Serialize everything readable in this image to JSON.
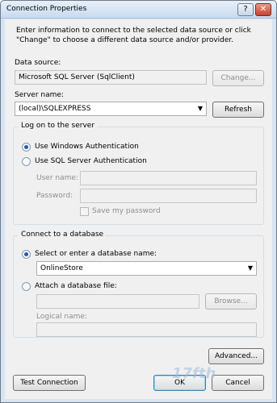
{
  "window": {
    "title": "Connection Properties",
    "help_button": "?",
    "close_button": "✕"
  },
  "intro_text": "Enter information to connect to the selected data source or click \"Change\" to choose a different data source and/or provider.",
  "data_source": {
    "label": "Data source:",
    "value": "Microsoft SQL Server (SqlClient)",
    "change_button": "Change..."
  },
  "server": {
    "label": "Server name:",
    "value": "(local)\\SQLEXPRESS",
    "refresh_button": "Refresh"
  },
  "logon": {
    "title": "Log on to the server",
    "windows_auth": "Use Windows Authentication",
    "sql_auth": "Use SQL Server Authentication",
    "user_name_label": "User name:",
    "password_label": "Password:",
    "save_password": "Save my password",
    "selected": "windows"
  },
  "database": {
    "title": "Connect to a database",
    "select_option": "Select or enter a database name:",
    "database_name": "OnlineStore",
    "attach_option": "Attach a database file:",
    "browse_button": "Browse...",
    "logical_name_label": "Logical name:",
    "selected": "select"
  },
  "buttons": {
    "advanced": "Advanced...",
    "test_connection": "Test Connection",
    "ok": "OK",
    "cancel": "Cancel"
  },
  "watermark": "17fth"
}
